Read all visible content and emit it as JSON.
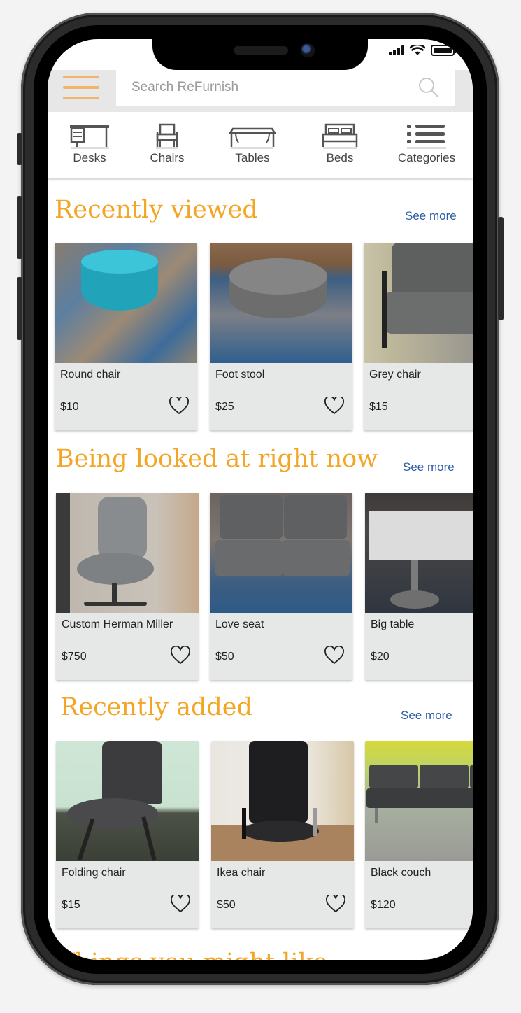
{
  "search": {
    "placeholder": "Search ReFurnish"
  },
  "colors": {
    "accent": "#f3a526",
    "link": "#2b5aa8",
    "menu": "#f0b56a"
  },
  "categories": [
    {
      "label": "Desks",
      "icon": "desk-icon"
    },
    {
      "label": "Chairs",
      "icon": "chair-icon"
    },
    {
      "label": "Tables",
      "icon": "table-icon"
    },
    {
      "label": "Beds",
      "icon": "bed-icon"
    },
    {
      "label": "Categories",
      "icon": "list-icon"
    }
  ],
  "sections": [
    {
      "title": "Recently viewed",
      "see_more": "See more",
      "items": [
        {
          "name": "Round chair",
          "price": "$10"
        },
        {
          "name": "Foot stool",
          "price": "$25"
        },
        {
          "name": "Grey chair",
          "price": "$15"
        }
      ]
    },
    {
      "title": "Being looked at right now",
      "see_more": "See more",
      "items": [
        {
          "name": "Custom Herman Miller",
          "price": "$750"
        },
        {
          "name": "Love seat",
          "price": "$50"
        },
        {
          "name": "Big table",
          "price": "$20"
        }
      ]
    },
    {
      "title": "Recently added",
      "see_more": "See more",
      "items": [
        {
          "name": "Folding chair",
          "price": "$15"
        },
        {
          "name": "Ikea chair",
          "price": "$50"
        },
        {
          "name": "Black couch",
          "price": "$120"
        }
      ]
    }
  ],
  "next_section_title": "Things you might like"
}
